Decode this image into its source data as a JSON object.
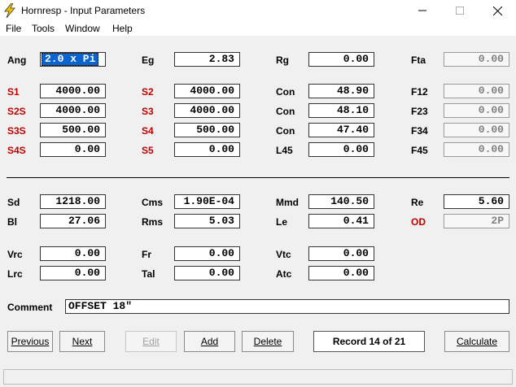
{
  "window": {
    "title": "Hornresp - Input Parameters"
  },
  "menu": [
    "File",
    "Tools",
    "Window",
    "Help"
  ],
  "rows": [
    [
      {
        "label": "Ang",
        "value": "2.0 x Pi",
        "red": false,
        "sel": true
      },
      {
        "label": "Eg",
        "value": "2.83",
        "red": false
      },
      {
        "label": "Rg",
        "value": "0.00",
        "red": false
      },
      {
        "label": "Fta",
        "value": "0.00",
        "red": false,
        "ro": true
      }
    ],
    [
      {
        "label": "S1",
        "value": "4000.00",
        "red": true
      },
      {
        "label": "S2",
        "value": "4000.00",
        "red": true
      },
      {
        "label": "Con",
        "value": "48.90",
        "red": false
      },
      {
        "label": "F12",
        "value": "0.00",
        "red": false,
        "ro": true
      }
    ],
    [
      {
        "label": "S2S",
        "value": "4000.00",
        "red": true
      },
      {
        "label": "S3",
        "value": "4000.00",
        "red": true
      },
      {
        "label": "Con",
        "value": "48.10",
        "red": false
      },
      {
        "label": "F23",
        "value": "0.00",
        "red": false,
        "ro": true
      }
    ],
    [
      {
        "label": "S3S",
        "value": "500.00",
        "red": true
      },
      {
        "label": "S4",
        "value": "500.00",
        "red": true
      },
      {
        "label": "Con",
        "value": "47.40",
        "red": false
      },
      {
        "label": "F34",
        "value": "0.00",
        "red": false,
        "ro": true
      }
    ],
    [
      {
        "label": "S4S",
        "value": "0.00",
        "red": true
      },
      {
        "label": "S5",
        "value": "0.00",
        "red": true
      },
      {
        "label": "L45",
        "value": "0.00",
        "red": false
      },
      {
        "label": "F45",
        "value": "0.00",
        "red": false,
        "ro": true
      }
    ],
    [
      {
        "label": "Sd",
        "value": "1218.00",
        "red": false
      },
      {
        "label": "Cms",
        "value": "1.90E-04",
        "red": false
      },
      {
        "label": "Mmd",
        "value": "140.50",
        "red": false
      },
      {
        "label": "Re",
        "value": "5.60",
        "red": false
      }
    ],
    [
      {
        "label": "Bl",
        "value": "27.06",
        "red": false
      },
      {
        "label": "Rms",
        "value": "5.03",
        "red": false
      },
      {
        "label": "Le",
        "value": "0.41",
        "red": false
      },
      {
        "label": "OD",
        "value": "2P",
        "red": true,
        "ro": true
      }
    ],
    [
      {
        "label": "Vrc",
        "value": "0.00",
        "red": false
      },
      {
        "label": "Fr",
        "value": "0.00",
        "red": false
      },
      {
        "label": "Vtc",
        "value": "0.00",
        "red": false
      }
    ],
    [
      {
        "label": "Lrc",
        "value": "0.00",
        "red": false
      },
      {
        "label": "Tal",
        "value": "0.00",
        "red": false
      },
      {
        "label": "Atc",
        "value": "0.00",
        "red": false
      }
    ]
  ],
  "comment": {
    "label": "Comment",
    "value": "OFFSET 18\""
  },
  "buttons": {
    "previous": "Previous",
    "next": "Next",
    "edit": "Edit",
    "add": "Add",
    "delete": "Delete",
    "calculate": "Calculate"
  },
  "record": "Record 14 of 21",
  "colors": {
    "param_red": "#c00000",
    "selection": "#0a64d0"
  }
}
